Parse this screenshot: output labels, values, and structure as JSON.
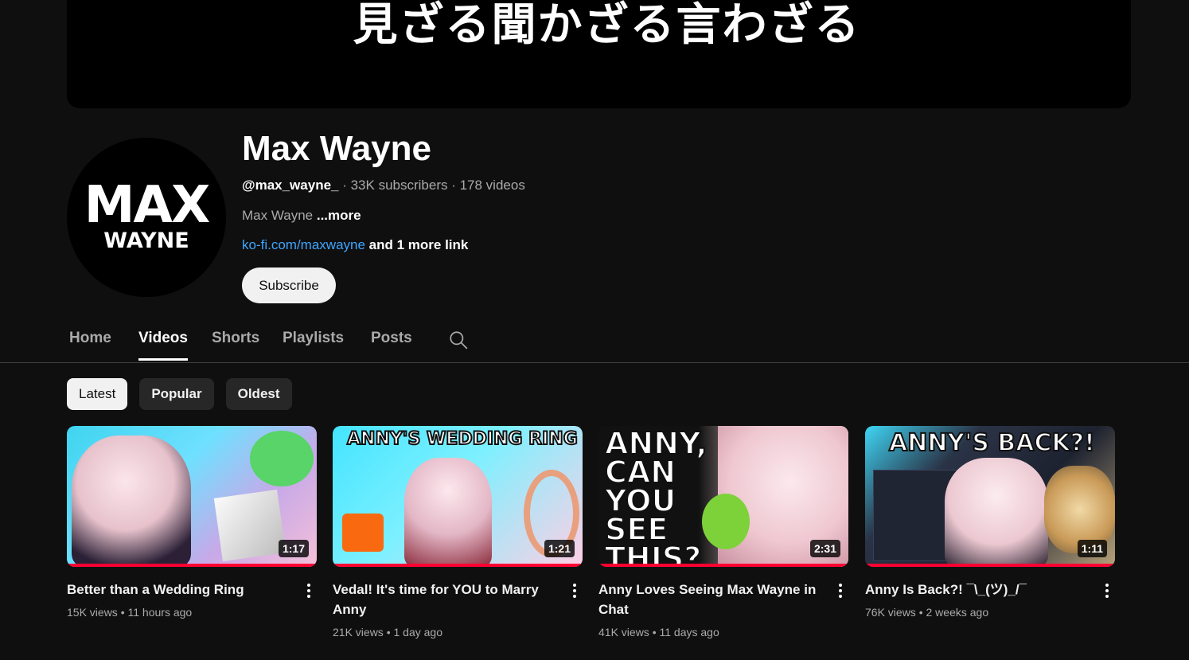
{
  "banner": {
    "text": "見ざる聞かざる言わざる"
  },
  "channel": {
    "avatar_line1": "MAX",
    "avatar_line2": "WAYNE",
    "name": "Max Wayne",
    "handle": "@max_wayne_",
    "stats": " · 33K subscribers · 178 videos",
    "description": "Max Wayne ",
    "description_more": "...more",
    "link": "ko-fi.com/maxwayne",
    "link_more": " and 1 more link",
    "subscribe_label": "Subscribe"
  },
  "tabs": [
    {
      "label": "Home"
    },
    {
      "label": "Videos"
    },
    {
      "label": "Shorts"
    },
    {
      "label": "Playlists"
    },
    {
      "label": "Posts"
    }
  ],
  "chips": [
    {
      "label": "Latest"
    },
    {
      "label": "Popular"
    },
    {
      "label": "Oldest"
    }
  ],
  "videos": [
    {
      "title": "Better than a Wedding Ring",
      "views": "15K views",
      "age": "11 hours ago",
      "duration": "1:17",
      "thumb_text": ""
    },
    {
      "title": "Vedal! It's time for YOU to Marry Anny",
      "views": "21K views",
      "age": "1 day ago",
      "duration": "1:21",
      "thumb_text": "ANNY'S WEDDING RING"
    },
    {
      "title": "Anny Loves Seeing Max Wayne in Chat",
      "views": "41K views",
      "age": "11 days ago",
      "duration": "2:31",
      "thumb_text": "ANNY, CAN YOU SEE THIS?"
    },
    {
      "title": "Anny Is Back?! ¯\\_(ツ)_/¯",
      "views": "76K views",
      "age": "2 weeks ago",
      "duration": "1:11",
      "thumb_text": "ANNY'S BACK?!"
    }
  ],
  "colors": {
    "background": "#0f0f0f",
    "link": "#3ea6ff",
    "progress": "#ff0033"
  }
}
